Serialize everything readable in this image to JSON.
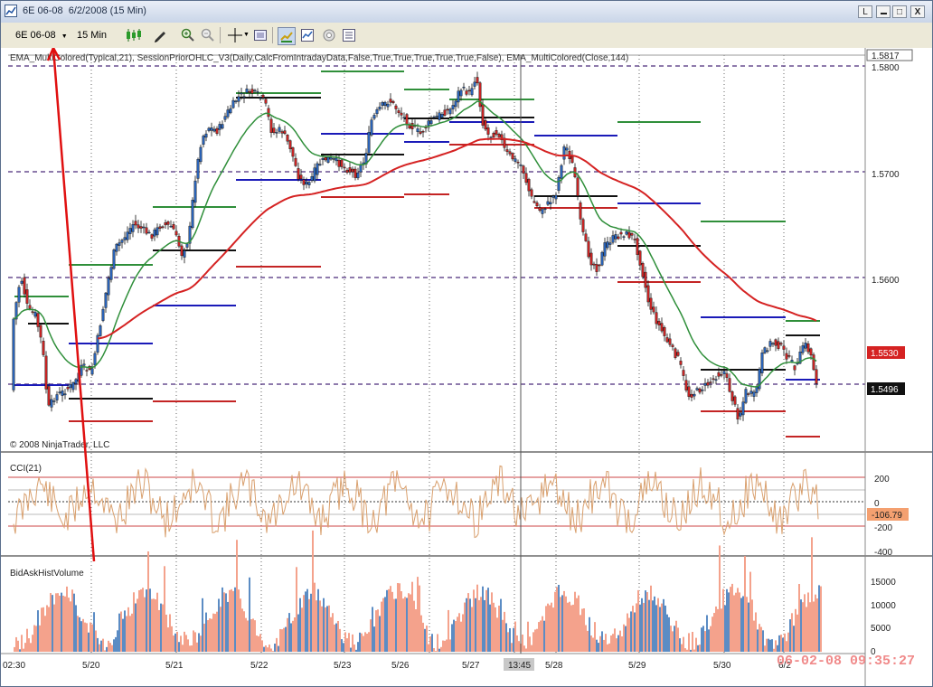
{
  "window": {
    "title": "6E 06-08  6/2/2008 (15 Min)",
    "buttons": [
      "L",
      "□",
      "X"
    ]
  },
  "toolbar": {
    "instrument": "6E 06-08",
    "interval": "15 Min"
  },
  "chart": {
    "indicator_label": "EMA_MultiColored(Typical,21),  SessionPriorOHLC_V3(Daily,CalcFromIntradayData,False,True,True,True,True,True,False),  EMA_MultiColored(Close,144)",
    "copyright": "© 2008 NinjaTrader, LLC",
    "price_ticks": [
      "1.5800",
      "1.5700",
      "1.5600"
    ],
    "price_top_label": "1.5817",
    "last_price_red": "1.5530",
    "last_price_black": "1.5496",
    "cci_title": "CCI(21)",
    "cci_ticks": [
      "200",
      "0",
      "-200",
      "-400"
    ],
    "cci_value": "-106.79",
    "volume_title": "BidAskHistVolume",
    "volume_ticks": [
      "15000",
      "10000",
      "5000",
      "0"
    ],
    "time_labels": [
      "02:30",
      "5/20",
      "5/21",
      "5/22",
      "5/23",
      "5/26",
      "5/27",
      "13:45",
      "5/28",
      "5/29",
      "5/30",
      "6/2"
    ],
    "timestamp": "06-02-08 09:35:27"
  },
  "colors": {
    "up_candle": "#2a62b5",
    "down_candle": "#c42424",
    "ema_fast": "#2f8f3a",
    "ema_slow": "#d52222",
    "session_line": "#1a1ab8",
    "volume_bid": "#f4a28c",
    "volume_ask": "#5b8cc4",
    "cci_line": "#d9a06e",
    "annotation": "#e01010"
  }
}
